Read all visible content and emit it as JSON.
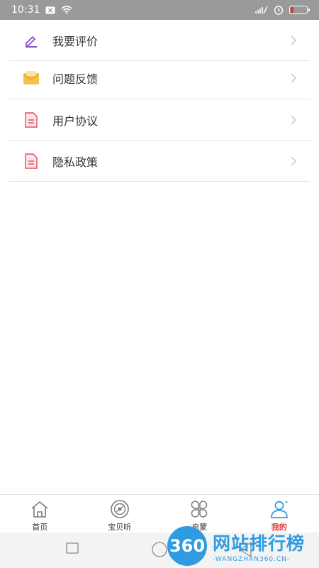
{
  "status_bar": {
    "time": "10:31",
    "icons": [
      "close-box-icon",
      "wifi-icon",
      "signal-icon",
      "alarm-icon",
      "battery-icon"
    ],
    "battery_level": 0.15,
    "battery_color": "#e33333"
  },
  "menu": {
    "items": [
      {
        "label": "我要评价",
        "icon": "edit-icon",
        "color": "#7b43c6"
      },
      {
        "label": "问题反馈",
        "icon": "mail-icon",
        "color": "#f0b43a"
      },
      {
        "label": "用户协议",
        "icon": "document-icon",
        "color": "#e0525a"
      },
      {
        "label": "隐私政策",
        "icon": "document-icon",
        "color": "#e0525a"
      }
    ]
  },
  "tabs": [
    {
      "label": "首页",
      "icon": "home-icon",
      "active": false
    },
    {
      "label": "宝贝听",
      "icon": "disc-icon",
      "active": false
    },
    {
      "label": "启蒙",
      "icon": "clover-icon",
      "active": false
    },
    {
      "label": "我的",
      "icon": "user-icon",
      "active": true
    }
  ],
  "accent_color": "#e0312f",
  "icon_accent_color": "#2f9be0",
  "watermark": {
    "badge": "360",
    "title": "网站排行榜",
    "subtitle": "-WANGZHAN360.CN-"
  }
}
